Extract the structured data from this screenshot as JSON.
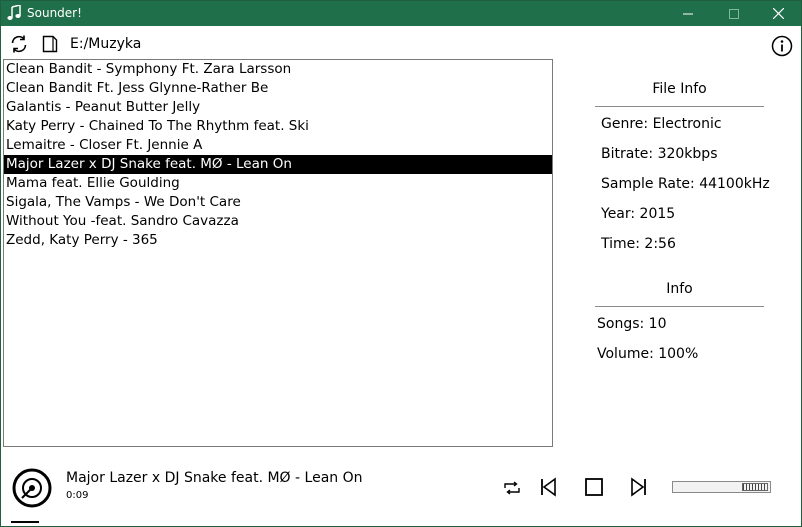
{
  "window": {
    "title": "Sounder!",
    "accent": "#1f6f4a",
    "icon": "music-note-icon"
  },
  "toolbar": {
    "refresh_icon": "refresh-icon",
    "folder_icon": "document-icon",
    "path": "E:/Muzyka",
    "info_icon": "info-icon"
  },
  "songs": [
    "Clean Bandit - Symphony Ft. Zara Larsson",
    "Clean Bandit Ft. Jess Glynne-Rather Be",
    "Galantis - Peanut Butter Jelly",
    "Katy Perry - Chained To The Rhythm feat. Ski",
    "Lemaitre - Closer Ft. Jennie A",
    "Major Lazer x DJ Snake feat. MØ - Lean On",
    "Mama feat. Ellie Goulding",
    "Sigala, The Vamps - We Don't Care",
    "Without You -feat. Sandro Cavazza",
    "Zedd, Katy Perry - 365"
  ],
  "selected_index": 5,
  "file_info": {
    "heading": "File Info",
    "genre": "Genre: Electronic",
    "bitrate": "Bitrate: 320kbps",
    "sample_rate": "Sample Rate: 44100kHz",
    "year": "Year: 2015",
    "time": "Time: 2:56"
  },
  "info": {
    "heading": "Info",
    "songs": "Songs: 10",
    "volume": "Volume: 100%"
  },
  "player": {
    "now_playing": "Major Lazer x DJ Snake feat. MØ - Lean On",
    "elapsed": "0:09",
    "volume_level": 1.0
  }
}
